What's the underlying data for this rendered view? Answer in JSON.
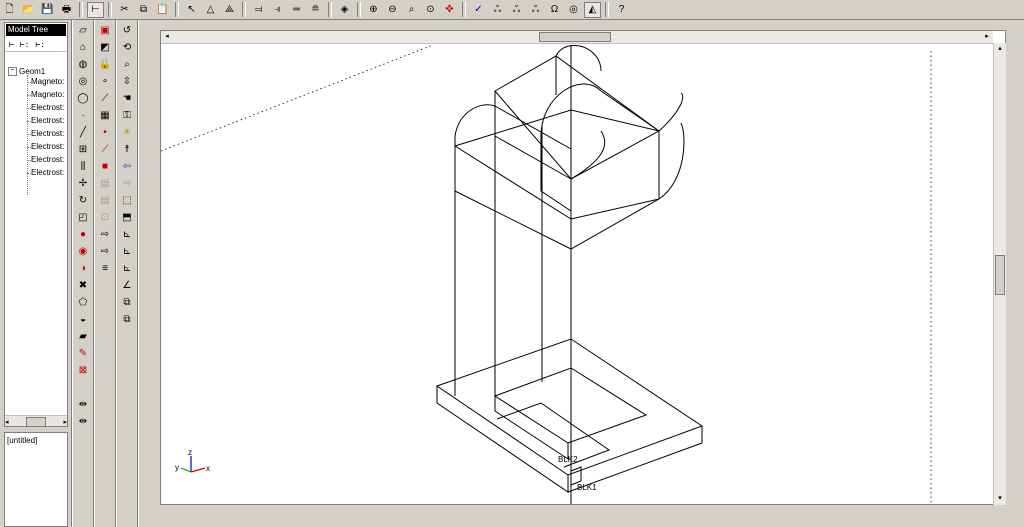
{
  "toolbar": {
    "icons": [
      "new-file-icon",
      "open-folder-icon",
      "save-icon",
      "print-icon",
      "tree-toggle-icon",
      "cut-icon",
      "copy-icon",
      "paste-icon",
      "select-arrow-icon",
      "triangle-icon",
      "triangle-mesh-icon",
      "align-left-icon",
      "align-right-icon",
      "equal-icon",
      "align-top-icon",
      "view-icon",
      "zoom-in-icon",
      "zoom-out-icon",
      "zoom-window-icon",
      "zoom-fit-icon",
      "rotate-icon",
      "check-icon",
      "analyze-icon",
      "analyze-multi-icon",
      "analyze-alt-icon",
      "omega-icon",
      "target-icon",
      "camera-icon",
      "help-icon"
    ]
  },
  "tree": {
    "title": "Model Tree",
    "tools": [
      "⊢",
      "⊢:",
      "⊢:"
    ],
    "root": "Geom1",
    "items": [
      "Magneto:",
      "Magneto:",
      "Electrost:",
      "Electrost:",
      "Electrost:",
      "Electrost:",
      "Electrost:",
      "Electrost:"
    ]
  },
  "documents": {
    "items": [
      "[untitled]"
    ]
  },
  "scene": {
    "labels": {
      "blk2": "BLK2",
      "blk1": "BLK1"
    },
    "axes": {
      "x": "x",
      "y": "y",
      "z": "z"
    },
    "colors": {
      "x_axis": "#d00000",
      "y_axis": "#00a000",
      "z_axis": "#0000d0"
    }
  }
}
